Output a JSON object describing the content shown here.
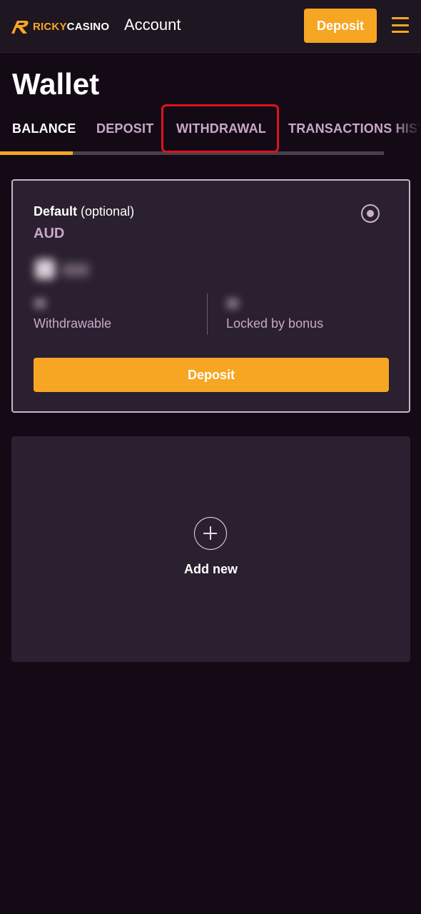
{
  "header": {
    "logo": {
      "part1": "RICKY",
      "part2": "CASINO"
    },
    "title": "Account",
    "deposit_label": "Deposit"
  },
  "page": {
    "title": "Wallet"
  },
  "tabs": [
    {
      "label": "BALANCE",
      "active": true
    },
    {
      "label": "DEPOSIT",
      "active": false
    },
    {
      "label": "WITHDRAWAL",
      "active": false
    },
    {
      "label": "TRANSACTIONS HISTORY",
      "active": false
    }
  ],
  "wallet": {
    "name": "Default",
    "name_suffix": "(optional)",
    "currency": "AUD",
    "withdrawable_label": "Withdrawable",
    "locked_label": "Locked by bonus",
    "deposit_label": "Deposit"
  },
  "add_new": {
    "label": "Add new"
  },
  "colors": {
    "accent": "#f6a623",
    "background": "#130a16",
    "card": "#2a2030",
    "highlight": "#e0121c"
  }
}
